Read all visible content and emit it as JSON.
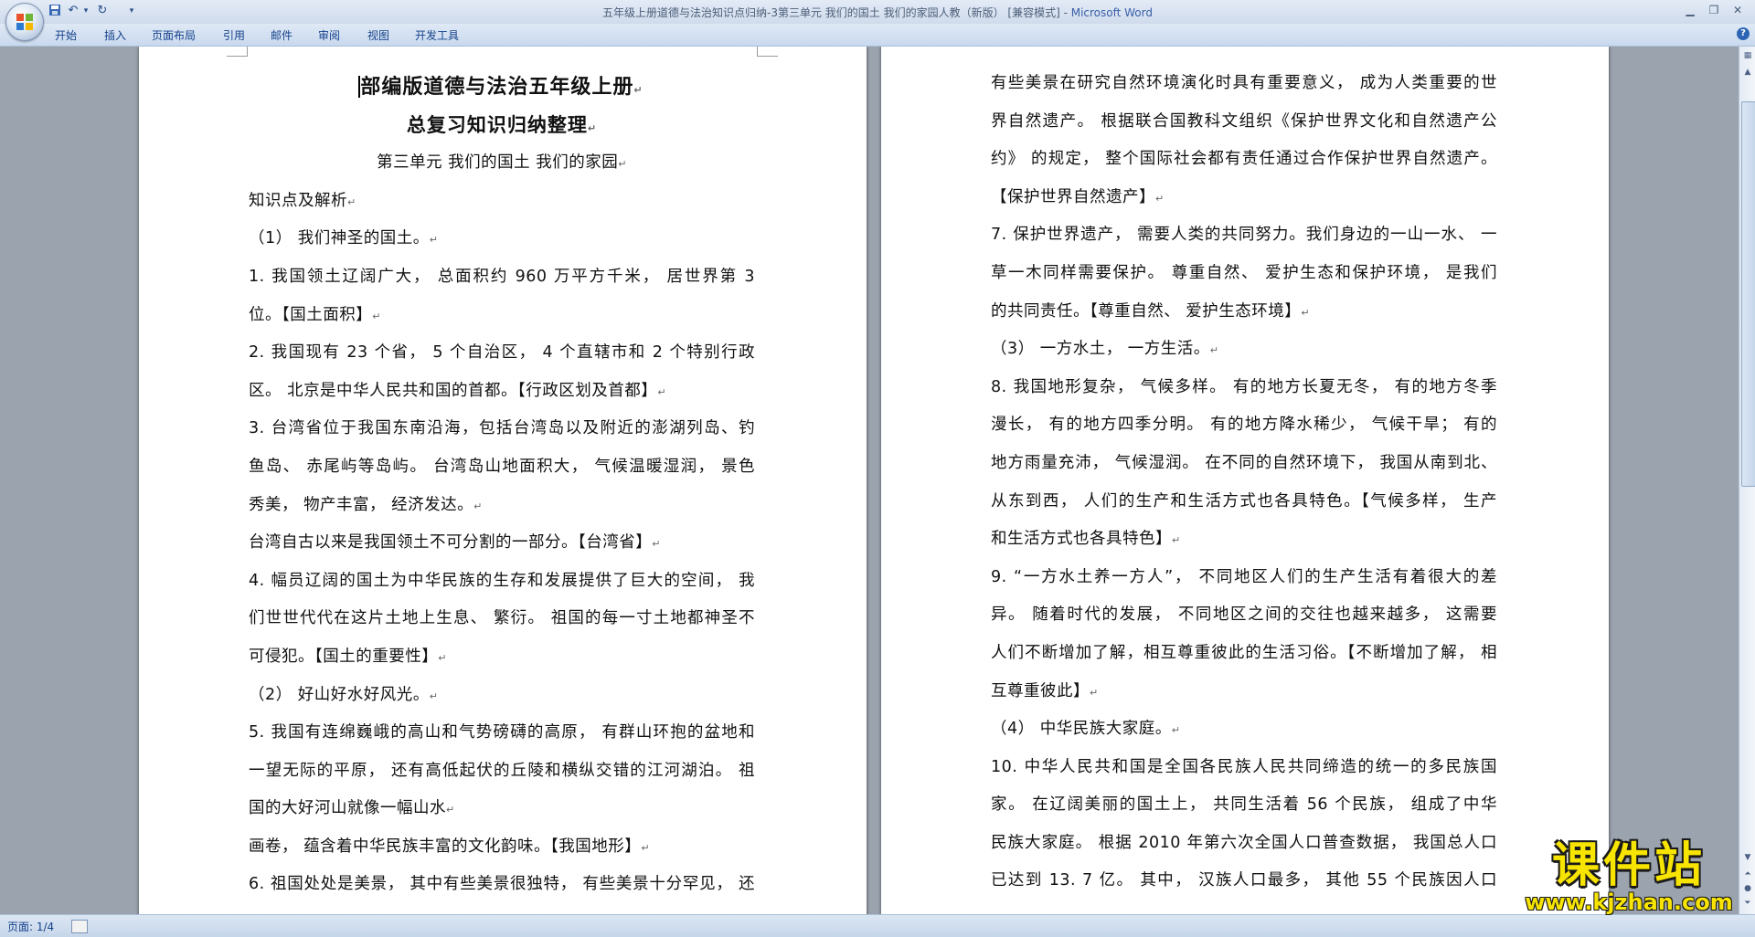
{
  "window": {
    "title": "五年级上册道德与法治知识点归纳-3第三单元 我们的国土 我们的家园人教（新版） [兼容模式] - ",
    "app_name": "Microsoft Word"
  },
  "ribbon": {
    "tabs": [
      "开始",
      "插入",
      "页面布局",
      "引用",
      "邮件",
      "审阅",
      "视图",
      "开发工具"
    ]
  },
  "status": {
    "page": "页面: 1/4"
  },
  "watermark": {
    "main": "课件站",
    "url": "www.kjzhan.com"
  },
  "paragraph_mark": "↵",
  "page_left": {
    "lines": [
      {
        "t": "部编版道德与法治五年级上册",
        "s": "h1 center"
      },
      {
        "t": "总复习知识归纳整理",
        "s": "h2 center"
      },
      {
        "t": "第三单元  我们的国土  我们的家园",
        "s": "center"
      },
      {
        "t": "知识点及解析",
        "s": ""
      },
      {
        "t": "（1） 我们神圣的国土。",
        "s": ""
      },
      {
        "t": "1. 我国领土辽阔广大， 总面积约 960 万平方千米， 居世界第 3",
        "s": "just"
      },
      {
        "t": "位。【国土面积】",
        "s": ""
      },
      {
        "t": "2. 我国现有 23 个省， 5 个自治区， 4 个直辖市和 2 个特别行政",
        "s": "just"
      },
      {
        "t": "区。 北京是中华人民共和国的首都。【行政区划及首都】",
        "s": ""
      },
      {
        "t": "3. 台湾省位于我国东南沿海，包括台湾岛以及附近的澎湖列岛、钓",
        "s": "just"
      },
      {
        "t": "鱼岛、 赤尾屿等岛屿。 台湾岛山地面积大， 气候温暖湿润， 景色",
        "s": "just"
      },
      {
        "t": "秀美， 物产丰富， 经济发达。",
        "s": ""
      },
      {
        "t": "台湾自古以来是我国领土不可分割的一部分。【台湾省】",
        "s": ""
      },
      {
        "t": "4. 幅员辽阔的国土为中华民族的生存和发展提供了巨大的空间， 我",
        "s": "just"
      },
      {
        "t": "们世世代代在这片土地上生息、 繁衍。 祖国的每一寸土地都神圣不",
        "s": "just"
      },
      {
        "t": "可侵犯。【国土的重要性】",
        "s": ""
      },
      {
        "t": "（2） 好山好水好风光。",
        "s": ""
      },
      {
        "t": "5. 我国有连绵巍峨的高山和气势磅礴的高原， 有群山环抱的盆地和",
        "s": "just"
      },
      {
        "t": "一望无际的平原， 还有高低起伏的丘陵和横纵交错的江河湖泊。 祖",
        "s": "just"
      },
      {
        "t": "国的大好河山就像一幅山水",
        "s": ""
      },
      {
        "t": "画卷， 蕴含着中华民族丰富的文化韵味。【我国地形】",
        "s": ""
      },
      {
        "t": "6. 祖国处处是美景， 其中有些美景很独特， 有些美景十分罕见， 还",
        "s": "just nomark"
      }
    ]
  },
  "page_right": {
    "lines": [
      {
        "t": "有些美景在研究自然环境演化时具有重要意义， 成为人类重要的世",
        "s": "just"
      },
      {
        "t": "界自然遗产。 根据联合国教科文组织《保护世界文化和自然遗产公",
        "s": "just"
      },
      {
        "t": "约》 的规定， 整个国际社会都有责任通过合作保护世界自然遗产。",
        "s": "just"
      },
      {
        "t": "【保护世界自然遗产】",
        "s": ""
      },
      {
        "t": "7. 保护世界遗产， 需要人类的共同努力。我们身边的一山一水、 一",
        "s": "just"
      },
      {
        "t": "草一木同样需要保护。 尊重自然、 爱护生态和保护环境， 是我们",
        "s": "just"
      },
      {
        "t": "的共同责任。【尊重自然、 爱护生态环境】",
        "s": ""
      },
      {
        "t": "（3） 一方水土， 一方生活。",
        "s": ""
      },
      {
        "t": "8. 我国地形复杂， 气候多样。 有的地方长夏无冬， 有的地方冬季",
        "s": "just"
      },
      {
        "t": "漫长， 有的地方四季分明。 有的地方降水稀少， 气候干旱； 有的",
        "s": "just"
      },
      {
        "t": "地方雨量充沛， 气候湿润。 在不同的自然环境下， 我国从南到北、",
        "s": "just"
      },
      {
        "t": "从东到西， 人们的生产和生活方式也各具特色。【气候多样， 生产",
        "s": "just"
      },
      {
        "t": "和生活方式也各具特色】",
        "s": ""
      },
      {
        "t": "9. “一方水土养一方人”， 不同地区人们的生产生活有着很大的差",
        "s": "just"
      },
      {
        "t": "异。 随着时代的发展， 不同地区之间的交往也越来越多， 这需要",
        "s": "just"
      },
      {
        "t": "人们不断增加了解，相互尊重彼此的生活习俗。【不断增加了解， 相",
        "s": "just"
      },
      {
        "t": "互尊重彼此】",
        "s": ""
      },
      {
        "t": "（4） 中华民族大家庭。",
        "s": ""
      },
      {
        "t": "10. 中华人民共和国是全国各民族人民共同缔造的统一的多民族国",
        "s": "just"
      },
      {
        "t": "家。 在辽阔美丽的国土上， 共同生活着 56 个民族， 组成了中华",
        "s": "just"
      },
      {
        "t": "民族大家庭。 根据 2010 年第六次全国人口普查数据， 我国总人口",
        "s": "just"
      },
      {
        "t": "已达到 13. 7 亿。 其中， 汉族人口最多， 其他 55 个民族因人口",
        "s": "just nomark"
      }
    ]
  }
}
